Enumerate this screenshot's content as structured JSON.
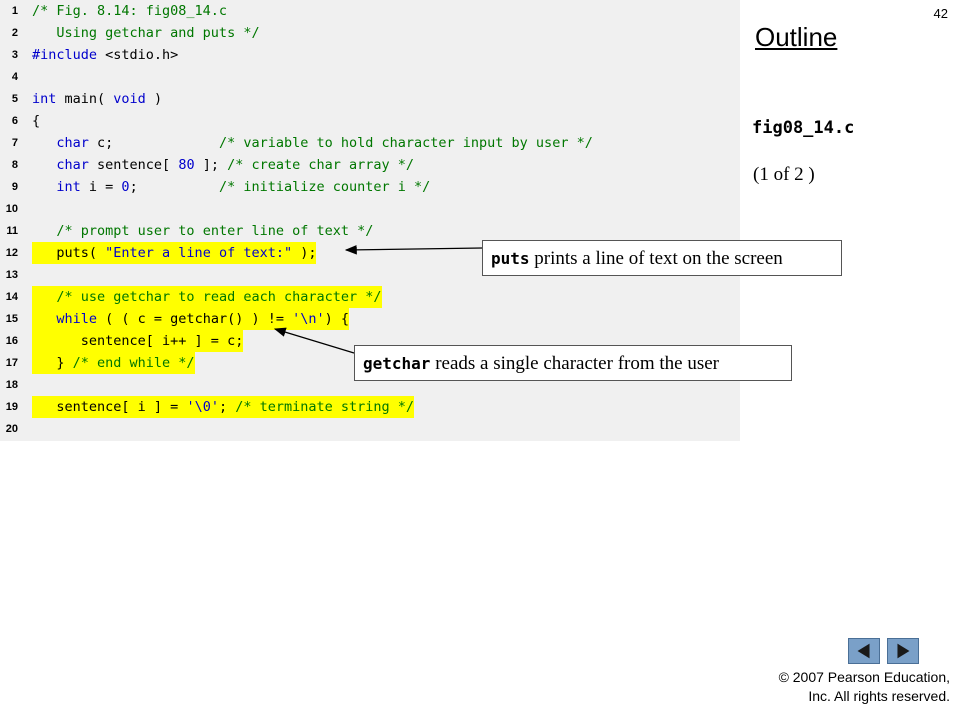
{
  "slide_number": "42",
  "outline": {
    "title": "Outline",
    "file_name": "fig08_14.c",
    "page_indicator": "(1 of 2 )"
  },
  "code_lines": [
    {
      "num": "1",
      "highlight": false,
      "tokens": [
        {
          "t": "cmt",
          "s": "/* Fig. 8.14: fig08_14.c"
        }
      ]
    },
    {
      "num": "2",
      "highlight": false,
      "tokens": [
        {
          "t": "cmt",
          "s": "   Using getchar and puts */"
        }
      ]
    },
    {
      "num": "3",
      "highlight": false,
      "tokens": [
        {
          "t": "kw",
          "s": "#include"
        },
        {
          "t": "plain",
          "s": " <stdio.h>"
        }
      ]
    },
    {
      "num": "4",
      "highlight": false,
      "tokens": []
    },
    {
      "num": "5",
      "highlight": false,
      "tokens": [
        {
          "t": "kw",
          "s": "int"
        },
        {
          "t": "plain",
          "s": " main( "
        },
        {
          "t": "kw",
          "s": "void"
        },
        {
          "t": "plain",
          "s": " )"
        }
      ]
    },
    {
      "num": "6",
      "highlight": false,
      "tokens": [
        {
          "t": "plain",
          "s": "{"
        }
      ]
    },
    {
      "num": "7",
      "highlight": false,
      "tokens": [
        {
          "t": "plain",
          "s": "   "
        },
        {
          "t": "kw",
          "s": "char"
        },
        {
          "t": "plain",
          "s": " c;             "
        },
        {
          "t": "cmt",
          "s": "/* variable to hold character input by user */"
        }
      ]
    },
    {
      "num": "8",
      "highlight": false,
      "tokens": [
        {
          "t": "plain",
          "s": "   "
        },
        {
          "t": "kw",
          "s": "char"
        },
        {
          "t": "plain",
          "s": " sentence[ "
        },
        {
          "t": "num",
          "s": "80"
        },
        {
          "t": "plain",
          "s": " ]; "
        },
        {
          "t": "cmt",
          "s": "/* create char array */"
        }
      ]
    },
    {
      "num": "9",
      "highlight": false,
      "tokens": [
        {
          "t": "plain",
          "s": "   "
        },
        {
          "t": "kw",
          "s": "int"
        },
        {
          "t": "plain",
          "s": " i = "
        },
        {
          "t": "num",
          "s": "0"
        },
        {
          "t": "plain",
          "s": ";          "
        },
        {
          "t": "cmt",
          "s": "/* initialize counter i */"
        }
      ]
    },
    {
      "num": "10",
      "highlight": false,
      "tokens": []
    },
    {
      "num": "11",
      "highlight": false,
      "tokens": [
        {
          "t": "plain",
          "s": "   "
        },
        {
          "t": "cmt",
          "s": "/* prompt user to enter line of text */"
        }
      ]
    },
    {
      "num": "12",
      "highlight": true,
      "tokens": [
        {
          "t": "plain",
          "s": "   puts( "
        },
        {
          "t": "str",
          "s": "\"Enter a line of text:\""
        },
        {
          "t": "plain",
          "s": " );"
        }
      ]
    },
    {
      "num": "13",
      "highlight": false,
      "tokens": []
    },
    {
      "num": "14",
      "highlight": true,
      "tokens": [
        {
          "t": "plain",
          "s": "   "
        },
        {
          "t": "cmt",
          "s": "/* use getchar to read each character */"
        }
      ]
    },
    {
      "num": "15",
      "highlight": true,
      "tokens": [
        {
          "t": "plain",
          "s": "   "
        },
        {
          "t": "kw",
          "s": "while"
        },
        {
          "t": "plain",
          "s": " ( ( c = getchar() ) != "
        },
        {
          "t": "str",
          "s": "'\\n'"
        },
        {
          "t": "plain",
          "s": ") {"
        }
      ]
    },
    {
      "num": "16",
      "highlight": true,
      "tokens": [
        {
          "t": "plain",
          "s": "      sentence[ i++ ] = c;"
        }
      ]
    },
    {
      "num": "17",
      "highlight": true,
      "tokens": [
        {
          "t": "plain",
          "s": "   } "
        },
        {
          "t": "cmt",
          "s": "/* end while */"
        }
      ]
    },
    {
      "num": "18",
      "highlight": false,
      "tokens": []
    },
    {
      "num": "19",
      "highlight": true,
      "tokens": [
        {
          "t": "plain",
          "s": "   sentence[ i ] = "
        },
        {
          "t": "str",
          "s": "'\\0'"
        },
        {
          "t": "plain",
          "s": "; "
        },
        {
          "t": "cmt",
          "s": "/* terminate string */"
        }
      ]
    },
    {
      "num": "20",
      "highlight": false,
      "tokens": []
    }
  ],
  "callouts": {
    "puts": {
      "term": "puts",
      "text": " prints a line of text on the screen"
    },
    "getchar": {
      "term": "getchar",
      "text": " reads a single character from the user"
    }
  },
  "nav": {
    "prev_icon": "triangle-left-icon",
    "next_icon": "triangle-right-icon"
  },
  "copyright": {
    "line1": "© 2007 Pearson Education,",
    "line2": "Inc.  All rights reserved."
  },
  "colors": {
    "code_background": "#f0f0f0",
    "keyword": "#0000cc",
    "comment": "#007700",
    "highlight": "#ffff00",
    "nav_button": "#7aa0c8"
  }
}
